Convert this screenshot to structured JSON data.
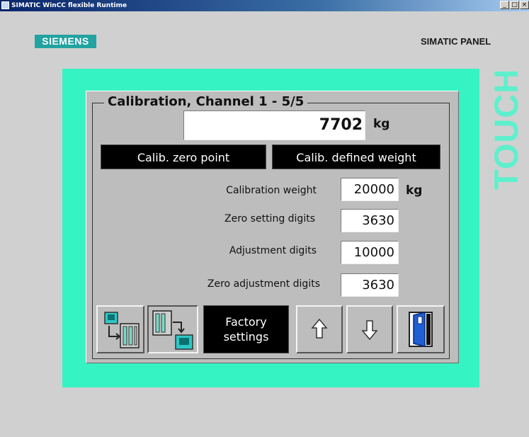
{
  "window": {
    "title": "SIMATIC WinCC flexible Runtime",
    "controls": [
      "_",
      "□",
      "×"
    ]
  },
  "device": {
    "brand": "SIEMENS",
    "panel_label": "SIMATIC PANEL",
    "touch_label": "TOUCH",
    "frame_color": "#36f3c3",
    "brand_color": "#22a3a1"
  },
  "screen": {
    "group_title": "Calibration, Channel 1 - 5/5",
    "current_weight": {
      "value": "7702",
      "unit": "kg"
    },
    "buttons": {
      "calib_zero": "Calib. zero point",
      "calib_weight": "Calib. defined weight",
      "factory_line1": "Factory",
      "factory_line2": "settings"
    },
    "fields": [
      {
        "label": "Calibration weight",
        "value": "20000",
        "unit": "kg"
      },
      {
        "label": "Zero setting digits",
        "value": "3630"
      },
      {
        "label": "Adjustment digits",
        "value": "10000"
      },
      {
        "label": "Zero adjustment digits",
        "value": "3630"
      }
    ],
    "toolbar_icons": [
      "download-to-device-icon",
      "upload-from-device-icon",
      "arrow-up-icon",
      "arrow-down-icon",
      "exit-door-icon"
    ]
  }
}
